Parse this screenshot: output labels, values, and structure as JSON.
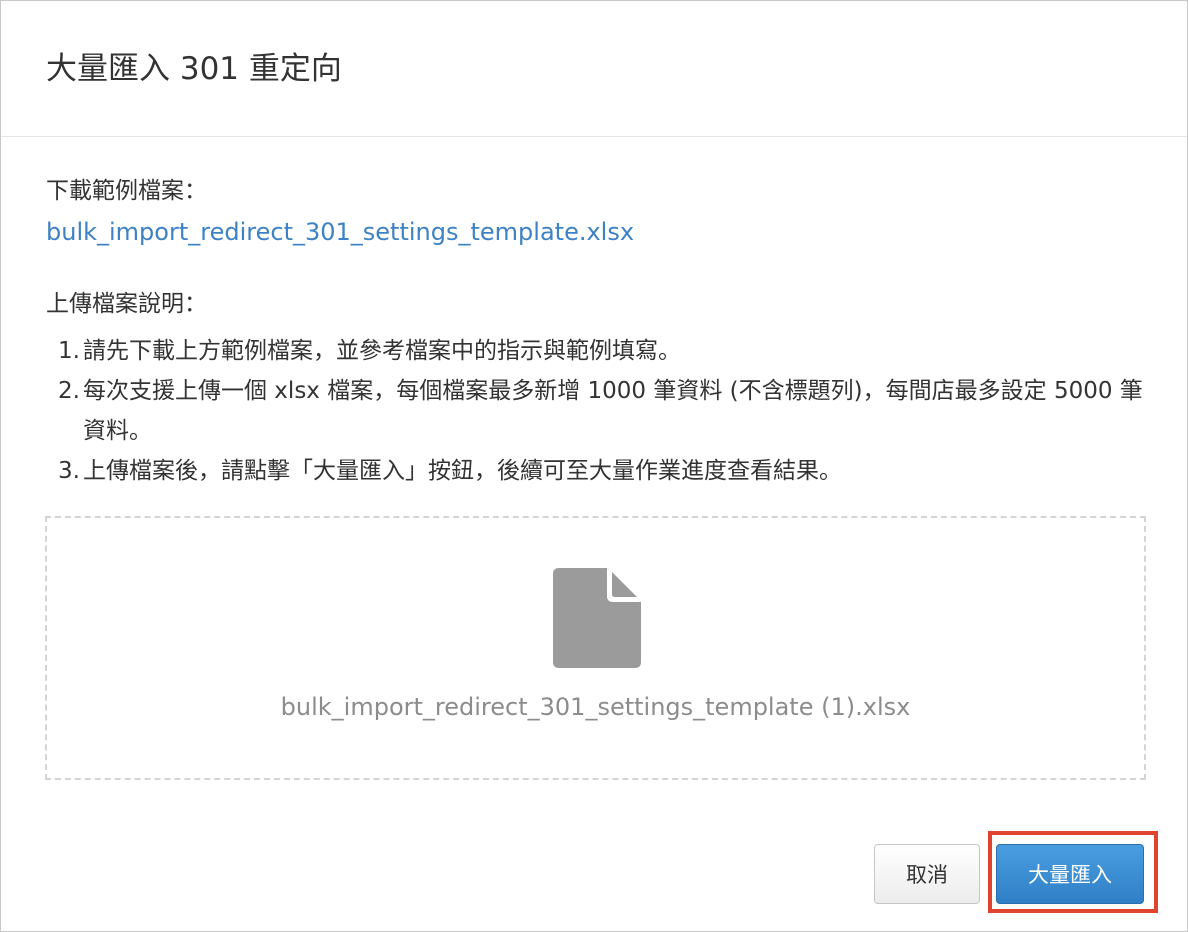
{
  "dialog": {
    "title": "大量匯入 301 重定向",
    "download_label": "下載範例檔案：",
    "template_link": "bulk_import_redirect_301_settings_template.xlsx",
    "instructions_label": "上傳檔案說明：",
    "instructions": [
      {
        "num": "1.",
        "text": "請先下載上方範例檔案，並參考檔案中的指示與範例填寫。"
      },
      {
        "num": "2.",
        "text": "每次支援上傳一個 xlsx 檔案，每個檔案最多新增 1000 筆資料 (不含標題列)，每間店最多設定 5000 筆資料。"
      },
      {
        "num": "3.",
        "text": "上傳檔案後，請點擊「大量匯入」按鈕，後續可至大量作業進度查看結果。"
      }
    ],
    "upload": {
      "icon": "file-icon",
      "file_name": "bulk_import_redirect_301_settings_template (1).xlsx"
    },
    "buttons": {
      "cancel": "取消",
      "import": "大量匯入"
    }
  },
  "colors": {
    "link": "#3d82c4",
    "primary_button": "#3a8dd5",
    "highlight_box": "#e0432f",
    "file_icon": "#9b9b9b",
    "file_name_text": "#8c8c8c"
  }
}
